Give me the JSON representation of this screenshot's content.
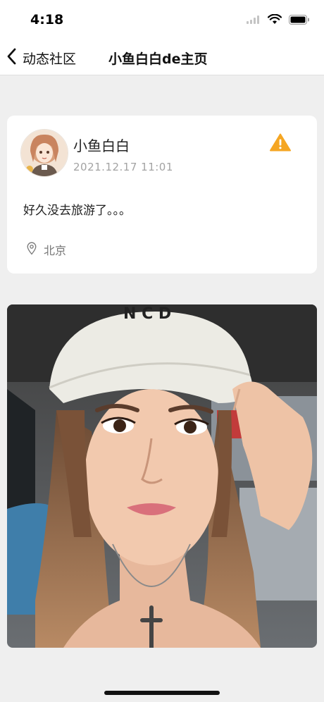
{
  "status_bar": {
    "time": "4:18"
  },
  "nav": {
    "back_label": "动态社区",
    "title": "小鱼白白de主页"
  },
  "post": {
    "user_name": "小鱼白白",
    "timestamp": "2021.12.17  11:01",
    "text": "好久没去旅游了。。。",
    "location": "北京",
    "report_icon": "warning-icon",
    "location_icon": "location-pin-icon"
  },
  "colors": {
    "warning": "#F5A623",
    "background": "#EFEFEF",
    "card": "#FFFFFF"
  }
}
